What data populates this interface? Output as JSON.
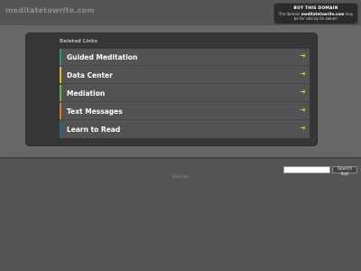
{
  "header": {
    "site_name": "meditatetowrite.com"
  },
  "buy_box": {
    "title": "BUY THIS DOMAIN",
    "desc_prefix": "The domain",
    "domain": "meditatetowrite.com",
    "desc_suffix": "may be for sale by its owner!"
  },
  "panel": {
    "title": "Related Links",
    "links": [
      {
        "label": "Guided Meditation",
        "accent": "#1b9a8a"
      },
      {
        "label": "Data Center",
        "accent": "#d8c21f"
      },
      {
        "label": "Mediation",
        "accent": "#6db33f"
      },
      {
        "label": "Text Messages",
        "accent": "#e0792a"
      },
      {
        "label": "Learn to Read",
        "accent": "#1b6f8a"
      }
    ],
    "arrow_icon": "right-arrow-icon",
    "arrow_color": "#b9d22e"
  },
  "search": {
    "button_label": "Search Ads",
    "input_value": ""
  },
  "footer": {
    "text": "Sitemaps"
  }
}
